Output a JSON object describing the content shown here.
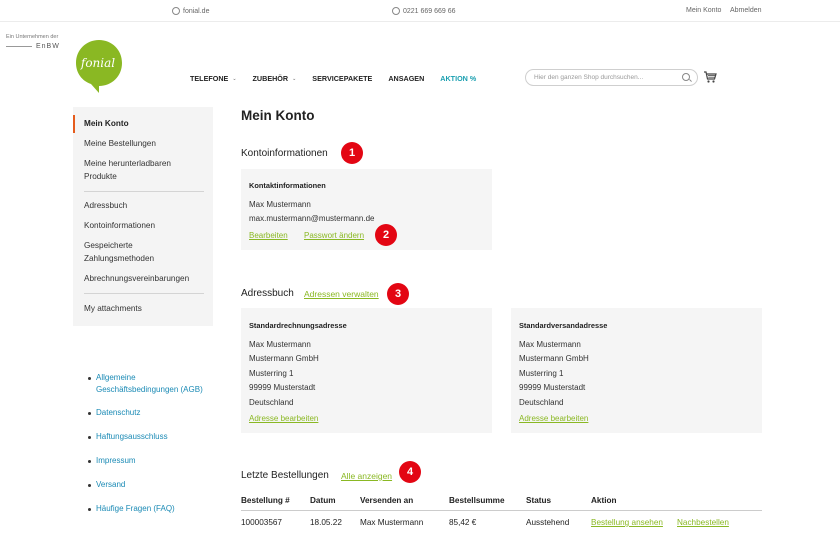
{
  "topbar": {
    "site": "fonial.de",
    "phone": "0221 669 669 66",
    "my_account": "Mein Konto",
    "logout": "Abmelden"
  },
  "header": {
    "enbw_line": "Ein Unternehmen der",
    "enbw_brand": "EnBW",
    "logo_text": "fonial",
    "logo_color": "#8ab823",
    "nav": [
      {
        "label": "TELEFONE",
        "caret": "⌄"
      },
      {
        "label": "ZUBEHÖR",
        "caret": "⌄"
      },
      {
        "label": "SERVICEPAKETE"
      },
      {
        "label": "ANSAGEN"
      },
      {
        "label": "AKTION %"
      }
    ],
    "search_placeholder": "Hier den ganzen Shop durchsuchen..."
  },
  "sidebar": {
    "items": [
      "Mein Konto",
      "Meine Bestellungen",
      "Meine herunterladbaren Produkte",
      "Adressbuch",
      "Kontoinformationen",
      "Gespeicherte Zahlungsmethoden",
      "Abrechnungsvereinbarungen",
      "My attachments"
    ]
  },
  "footer_links": [
    "Allgemeine Geschäftsbedingungen (AGB)",
    "Datenschutz",
    "Haftungsausschluss",
    "Impressum",
    "Versand",
    "Häufige Fragen (FAQ)"
  ],
  "main": {
    "title": "Mein Konto",
    "account_info": {
      "heading": "Kontoinformationen",
      "box_heading": "Kontaktinformationen",
      "name": "Max Mustermann",
      "email": "max.mustermann@mustermann.de",
      "edit": "Bearbeiten",
      "change_password": "Passwort ändern"
    },
    "address_book": {
      "heading": "Adressbuch",
      "manage": "Adressen verwalten",
      "billing": {
        "heading": "Standardrechnungsadresse",
        "lines": [
          "Max Mustermann",
          "Mustermann GmbH",
          "Musterring 1",
          "99999 Musterstadt",
          "Deutschland"
        ],
        "edit": "Adresse bearbeiten"
      },
      "shipping": {
        "heading": "Standardversandadresse",
        "lines": [
          "Max Mustermann",
          "Mustermann GmbH",
          "Musterring 1",
          "99999 Musterstadt",
          "Deutschland"
        ],
        "edit": "Adresse bearbeiten"
      }
    },
    "orders": {
      "heading": "Letzte Bestellungen",
      "show_all": "Alle anzeigen",
      "columns": [
        "Bestellung #",
        "Datum",
        "Versenden an",
        "Bestellsumme",
        "Status",
        "Aktion"
      ],
      "rows": [
        {
          "id": "100003567",
          "date": "18.05.22",
          "ship_to": "Max Mustermann",
          "total": "85,42 €",
          "status": "Ausstehend",
          "view": "Bestellung ansehen",
          "reorder": "Nachbestellen"
        }
      ]
    }
  },
  "badges": [
    "1",
    "2",
    "3",
    "4"
  ],
  "colors": {
    "accent_green": "#8ab823",
    "accent_teal": "#1a9fb0",
    "badge_red": "#e30613",
    "sidebar_marker": "#e55c1d",
    "link_blue": "#1a8ab5"
  }
}
